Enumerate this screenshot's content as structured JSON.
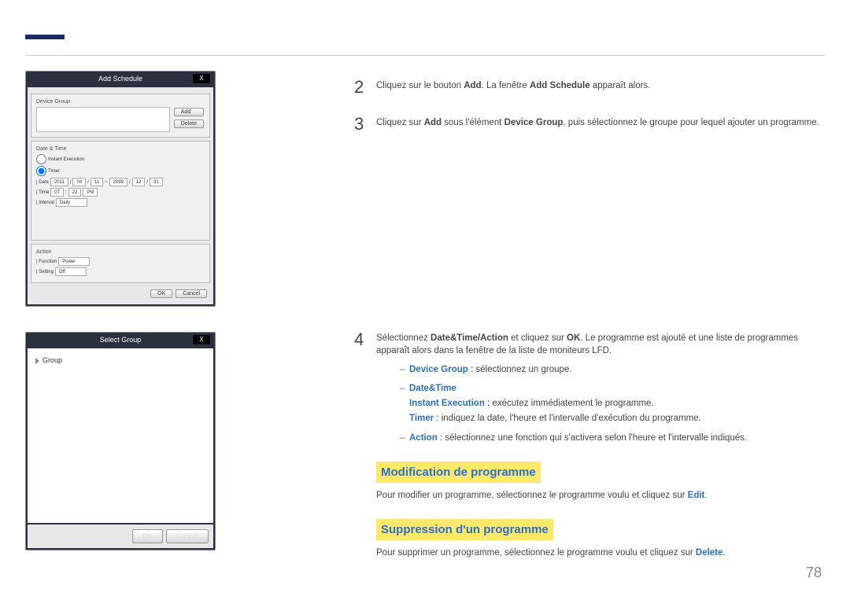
{
  "dialog1": {
    "title": "Add Schedule",
    "close": "X",
    "deviceGroupLabel": "Device Group",
    "addBtn": "Add",
    "deleteBtn": "Delete",
    "dateTimeLabel": "Date & Time",
    "instantExec": "Instant Execution",
    "timer": "Timer",
    "dateLabel": "| Date",
    "y1": "2011",
    "m1": "04",
    "d1": "11",
    "y2": "2099",
    "m2": "12",
    "d2": "31",
    "timeLabel": "| Time",
    "h": "07",
    "mi": "22",
    "ampm": "PM",
    "intervalLabel": "| Interval",
    "interval": "Daily",
    "actionLabel": "Action",
    "funcLabel": "| Function",
    "func": "Power",
    "settingLabel": "| Setting",
    "setting": "Off",
    "ok": "OK",
    "cancel": "Cancel"
  },
  "dialog2": {
    "title": "Select Group",
    "close": "X",
    "group": "Group",
    "ok": "OK",
    "cancel": "Cancel"
  },
  "step2": {
    "num": "2",
    "t1": "Cliquez sur le bouton ",
    "add": "Add",
    "t2": ". La fenêtre ",
    "win": "Add Schedule",
    "t3": " apparaît alors."
  },
  "step3": {
    "num": "3",
    "t1": "Cliquez sur ",
    "add": "Add",
    "t2": " sous l'élément ",
    "dg": "Device Group",
    "t3": ", puis sélectionnez le groupe pour lequel ajouter un programme."
  },
  "step4": {
    "num": "4",
    "t1": "Sélectionnez ",
    "dta": "Date&Time/Action",
    "t2": " et cliquez sur ",
    "ok": "OK",
    "t3": ". Le programme est ajouté et une liste de programmes apparaît alors dans la fenêtre de la liste de moniteurs LFD.",
    "sub1_b": "Device Group",
    "sub1_t": " : sélectionnez un groupe.",
    "sub2_b": "Date&Time",
    "sub2_ie": "Instant Execution",
    "sub2_ie_t": " : exécutez immédiatement le programme.",
    "sub2_tm": "Timer",
    "sub2_tm_t": " : indiquez la date, l'heure et l'intervalle d'exécution du programme.",
    "sub3_b": "Action",
    "sub3_t": " : sélectionnez une fonction qui s'activera selon l'heure et l'intervalle indiqués."
  },
  "modHdr": "Modification de programme",
  "modPara_t1": "Pour modifier un programme, sélectionnez le programme voulu et cliquez sur ",
  "modPara_b": "Edit",
  "modPara_t2": ".",
  "supHdr": "Suppression d'un programme",
  "supPara_t1": "Pour supprimer un programme, sélectionnez le programme voulu et cliquez sur ",
  "supPara_b": "Delete",
  "supPara_t2": ".",
  "pageNum": "78"
}
